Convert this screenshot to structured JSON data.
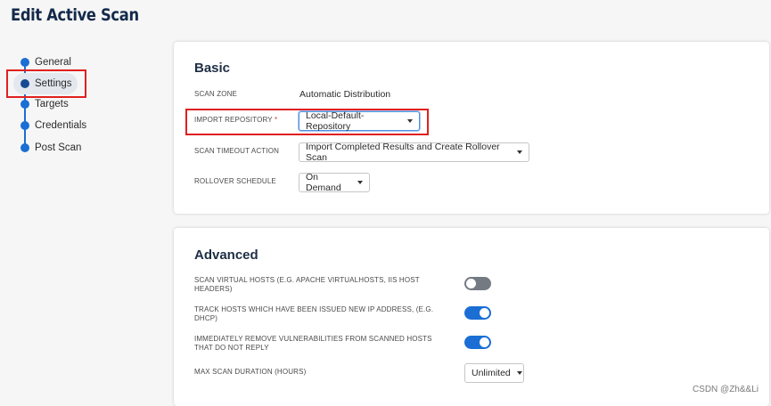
{
  "page": {
    "title": "Edit Active Scan"
  },
  "sidebar": {
    "items": [
      {
        "label": "General",
        "active": false
      },
      {
        "label": "Settings",
        "active": true
      },
      {
        "label": "Targets",
        "active": false
      },
      {
        "label": "Credentials",
        "active": false
      },
      {
        "label": "Post Scan",
        "active": false
      }
    ]
  },
  "basic": {
    "title": "Basic",
    "scan_zone": {
      "label": "SCAN ZONE",
      "value": "Automatic Distribution"
    },
    "import_repository": {
      "label": "IMPORT REPOSITORY",
      "required_mark": "*",
      "value": "Local-Default-Repository"
    },
    "scan_timeout_action": {
      "label": "SCAN TIMEOUT ACTION",
      "value": "Import Completed Results and Create Rollover Scan"
    },
    "rollover_schedule": {
      "label": "ROLLOVER SCHEDULE",
      "value": "On Demand"
    }
  },
  "advanced": {
    "title": "Advanced",
    "scan_virtual_hosts": {
      "label_line1": "SCAN VIRTUAL HOSTS (E.G. APACHE VIRTUALHOSTS, IIS HOST",
      "label_line2": "HEADERS)",
      "enabled": false
    },
    "track_hosts": {
      "label_line1": "TRACK HOSTS WHICH HAVE BEEN ISSUED NEW IP ADDRESS, (E.G.",
      "label_line2": "DHCP)",
      "enabled": true
    },
    "remove_vulns": {
      "label_line1": "IMMEDIATELY REMOVE VULNERABILITIES FROM SCANNED HOSTS",
      "label_line2": "THAT DO NOT REPLY",
      "enabled": true
    },
    "max_scan_duration": {
      "label": "MAX SCAN DURATION (HOURS)",
      "value": "Unlimited"
    }
  },
  "watermark": "CSDN @Zh&&Li",
  "colors": {
    "accent": "#1a6ed4",
    "highlight": "#e02020",
    "title": "#142a4a"
  }
}
